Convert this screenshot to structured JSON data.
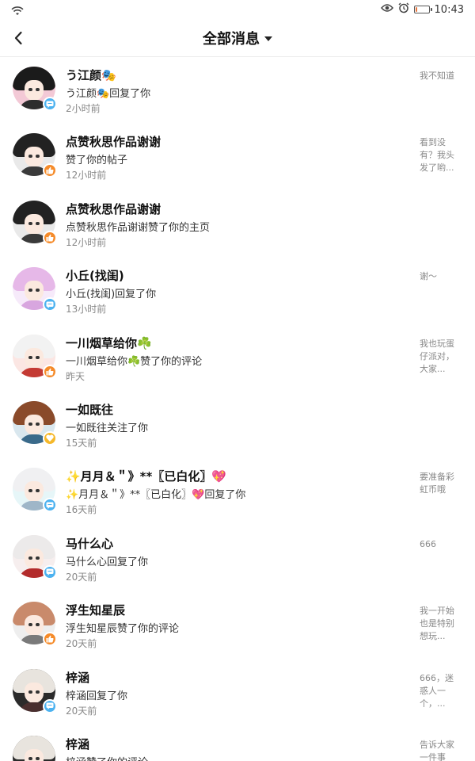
{
  "status_bar": {
    "wifi_icon": "wifi-icon",
    "eye_icon": "eye-icon",
    "alarm_icon": "alarm-icon",
    "battery_icon": "battery-icon",
    "battery_level": 0.15,
    "time": "10:43"
  },
  "header": {
    "title": "全部消息"
  },
  "colors": {
    "reply_badge": "#4cb2f0",
    "like_badge": "#f58b2a",
    "follow_badge": "#f5b82a"
  },
  "messages": [
    {
      "name": "う江颜🎭",
      "action": "う江颜🎭回复了你",
      "time": "2小时前",
      "preview": "我不知道",
      "badge": "reply"
    },
    {
      "name": "点赞秋思作品谢谢",
      "action": "赞了你的帖子",
      "time": "12小时前",
      "preview": "看到没有？我头发了哟...",
      "badge": "like"
    },
    {
      "name": "点赞秋思作品谢谢",
      "action": "点赞秋思作品谢谢赞了你的主页",
      "time": "12小时前",
      "preview": "",
      "badge": "like"
    },
    {
      "name": "小丘(找闺)",
      "action": "小丘(找闺)回复了你",
      "time": "13小时前",
      "preview": "谢～",
      "badge": "reply"
    },
    {
      "name": "一川烟草给你☘️",
      "action": "一川烟草给你☘️赞了你的评论",
      "time": "昨天",
      "preview": "我也玩蛋仔派对，大家...",
      "badge": "like"
    },
    {
      "name": "一如既往",
      "action": "一如既往关注了你",
      "time": "15天前",
      "preview": "",
      "badge": "follow"
    },
    {
      "name": "✨月月＆＂》**〖已白化〗💖",
      "action": "✨月月＆＂》**〖已白化〗💖回复了你",
      "time": "16天前",
      "preview": "要准备彩虹币哦",
      "badge": "reply"
    },
    {
      "name": "马什么心",
      "action": "马什么心回复了你",
      "time": "20天前",
      "preview": "666",
      "badge": "reply"
    },
    {
      "name": "浮生知星辰",
      "action": "浮生知星辰赞了你的评论",
      "time": "20天前",
      "preview": "我一开始也是特别想玩...",
      "badge": "like"
    },
    {
      "name": "梓涵",
      "action": "梓涵回复了你",
      "time": "20天前",
      "preview": "666，迷惑人一个，...",
      "badge": "reply"
    },
    {
      "name": "梓涵",
      "action": "梓涵赞了你的评论",
      "time": "",
      "preview": "告诉大家一件事",
      "badge": "like"
    }
  ]
}
